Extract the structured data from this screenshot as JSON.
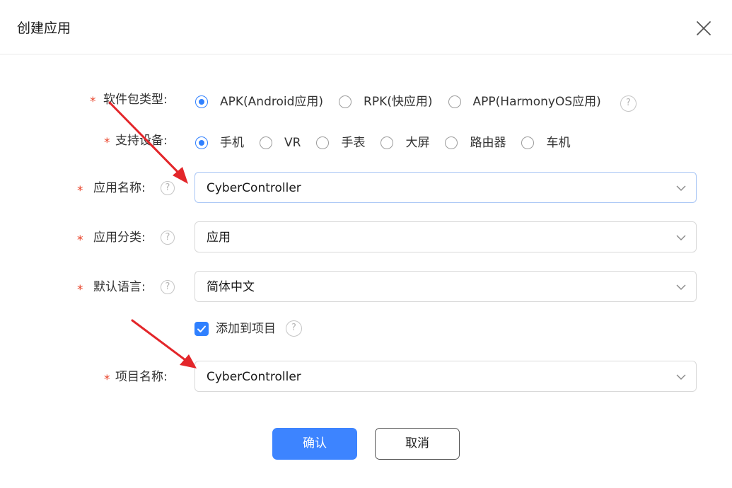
{
  "dialog": {
    "title": "创建应用",
    "close_icon": "close-icon"
  },
  "form": {
    "package_type": {
      "label": "软件包类型:",
      "required_mark": "*",
      "options": [
        "APK(Android应用)",
        "RPK(快应用)",
        "APP(HarmonyOS应用)"
      ],
      "selected": "APK(Android应用)"
    },
    "devices": {
      "label": "支持设备:",
      "required_mark": "*",
      "options": [
        "手机",
        "VR",
        "手表",
        "大屏",
        "路由器",
        "车机"
      ],
      "selected": "手机"
    },
    "app_name": {
      "label": "应用名称:",
      "required_mark": "*",
      "value": "CyberController"
    },
    "app_category": {
      "label": "应用分类:",
      "required_mark": "*",
      "value": "应用"
    },
    "default_language": {
      "label": "默认语言:",
      "required_mark": "*",
      "value": "简体中文"
    },
    "add_to_project": {
      "label": "添加到项目",
      "checked": true
    },
    "project_name": {
      "label": "项目名称:",
      "required_mark": "*",
      "value": "CyberController"
    },
    "help_glyph": "?"
  },
  "buttons": {
    "confirm": "确认",
    "cancel": "取消"
  },
  "colors": {
    "accent": "#2f80ff",
    "primary_button": "#3d84ff",
    "required": "#e84026",
    "annotation_arrow": "#e3262a"
  }
}
